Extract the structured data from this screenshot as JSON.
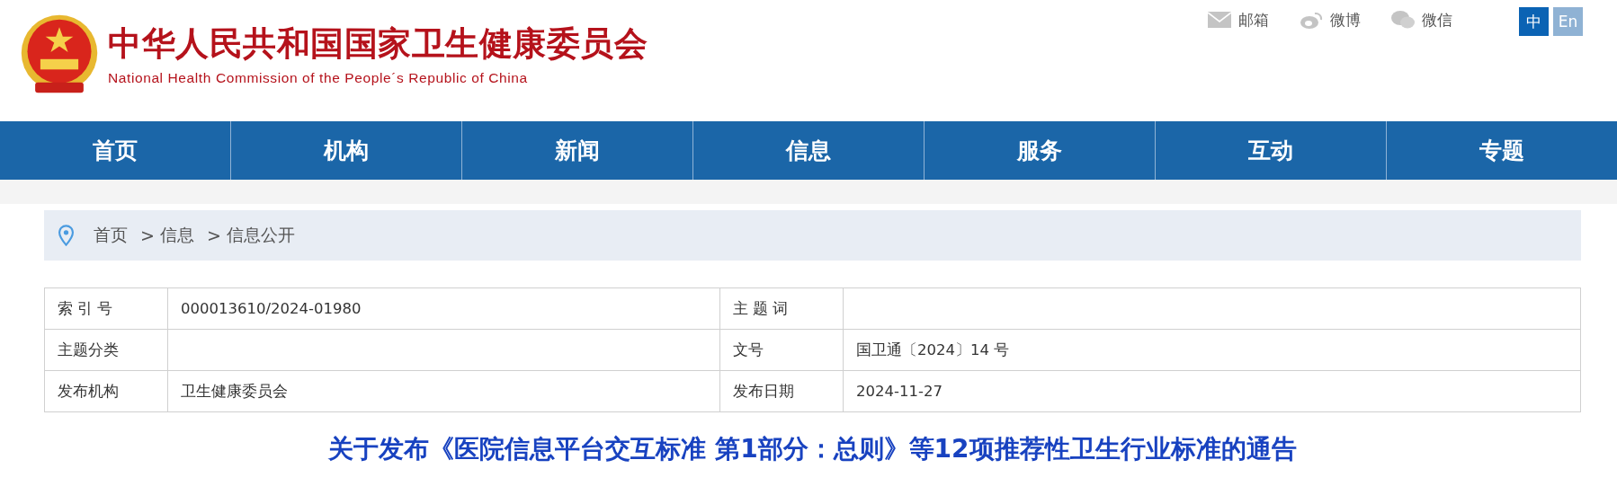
{
  "header": {
    "title": "中华人民共和国国家卫生健康委员会",
    "subtitle": "National Health Commission of the People´s Republic of China"
  },
  "top_links": [
    {
      "kind": "mail",
      "label": "邮箱"
    },
    {
      "kind": "weibo",
      "label": "微博"
    },
    {
      "kind": "wechat",
      "label": "微信"
    }
  ],
  "languages": [
    {
      "label": "中",
      "selected": true
    },
    {
      "label": "En",
      "selected": false
    }
  ],
  "nav": [
    "首页",
    "机构",
    "新闻",
    "信息",
    "服务",
    "互动",
    "专题"
  ],
  "breadcrumb": [
    {
      "label": "首页"
    },
    {
      "separator": ">",
      "label": "信息"
    },
    {
      "separator": ">",
      "label": "信息公开"
    }
  ],
  "info_table": [
    [
      {
        "label": "索 引 号",
        "value": "000013610/2024-01980"
      },
      {
        "label": "主 题 词"
      }
    ],
    [
      {
        "label": "主题分类"
      },
      {
        "label": "文号",
        "value": "国卫通〔2024〕14 号"
      }
    ],
    [
      {
        "label": "发布机构",
        "value": "卫生健康委员会"
      },
      {
        "label": "发布日期",
        "value": "2024-11-27"
      }
    ]
  ],
  "article": {
    "title": "关于发布《医院信息平台交互标准 第1部分：总则》等12项推荐性卫生行业标准的通告"
  }
}
